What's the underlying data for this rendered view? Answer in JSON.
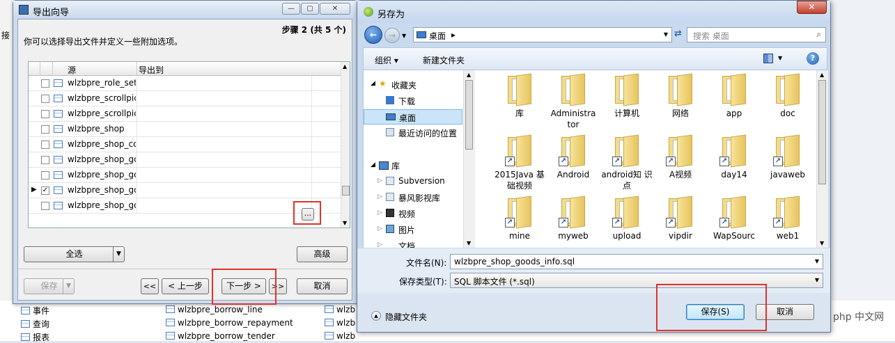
{
  "background": {
    "left_labels": [
      "接"
    ],
    "tree_items": [
      "事件",
      "查询",
      "报表"
    ],
    "tables_col1": [
      "wlzbpre_borrow_line",
      "wlzbpre_borrow_repayment",
      "wlzbpre_borrow_tender"
    ],
    "tables_col2": [
      "wlzb",
      "wlzb",
      "wlzb"
    ]
  },
  "wizard": {
    "title": "导出向导",
    "step": "步骤 2 (共 5 个)",
    "description": "你可以选择导出文件并定义一些附加选项。",
    "columns": {
      "source": "源",
      "export_to": "导出到"
    },
    "rows": [
      {
        "source": "wlzbpre_role_set",
        "checked": false,
        "current": false
      },
      {
        "source": "wlzbpre_scrollpic",
        "checked": false,
        "current": false
      },
      {
        "source": "wlzbpre_scrollpic",
        "checked": false,
        "current": false
      },
      {
        "source": "wlzbpre_shop",
        "checked": false,
        "current": false
      },
      {
        "source": "wlzbpre_shop_co",
        "checked": false,
        "current": false
      },
      {
        "source": "wlzbpre_shop_go",
        "checked": false,
        "current": false
      },
      {
        "source": "wlzbpre_shop_go",
        "checked": false,
        "current": false
      },
      {
        "source": "wlzbpre_shop_go",
        "checked": true,
        "current": true
      },
      {
        "source": "wlzbpre_shop_go",
        "checked": false,
        "current": false
      }
    ],
    "browse_label": "...",
    "select_all": "全选",
    "advanced": "高级",
    "save": "保存",
    "first": "<<",
    "prev": "< 上一步",
    "next": "下一步 >",
    "last": ">>",
    "cancel": "取消",
    "checkmark": "✓"
  },
  "save_dialog": {
    "title": "另存为",
    "address": "桌面",
    "address_arrow": "▸",
    "search_placeholder": "搜索 桌面",
    "organize": "组织 ▾",
    "new_folder": "新建文件夹",
    "help": "?",
    "nav": {
      "favorites": "收藏夹",
      "downloads": "下载",
      "desktop": "桌面",
      "recent": "最近访问的位置",
      "libraries": "库",
      "subversion": "Subversion",
      "storm": "暴风影视库",
      "videos": "视频",
      "pictures": "图片",
      "documents": "文档"
    },
    "files": [
      [
        "库",
        "Administra tor",
        "计算机",
        "网络",
        "app",
        "doc"
      ],
      [
        "2015Java 基础视频",
        "Android",
        "android知 识点",
        "A视频",
        "day14",
        "javaweb"
      ],
      [
        "mine",
        "myweb",
        "upload",
        "vipdir",
        "WapSourc",
        "web1"
      ]
    ],
    "filename_label": "文件名(N):",
    "filename": "wlzbpre_shop_goods_info.sql",
    "filetype_label": "保存类型(T):",
    "filetype": "SQL 脚本文件 (*.sql)",
    "hide_folders": "隐藏文件夹",
    "save_button": "保存(S)",
    "cancel_button": "取消"
  },
  "watermark": "php 中文网"
}
